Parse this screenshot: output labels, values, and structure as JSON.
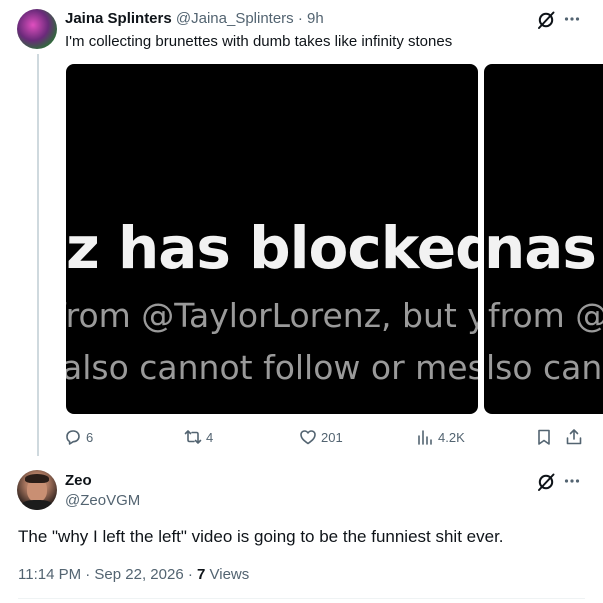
{
  "tweet1": {
    "author_name": "Jaina Splinters",
    "author_handle": "@Jaina_Splinters",
    "separator": " · ",
    "time": "9h",
    "text": "I'm collecting brunettes with dumb takes like infinity stones",
    "media": [
      {
        "line1": "z has blocked",
        "line2": "from @TaylorLorenz, but y",
        "line3": "also cannot follow or mess"
      },
      {
        "line1": "nas b",
        "line2": "from @",
        "line3": "lso can"
      }
    ],
    "actions": {
      "replies": "6",
      "reposts": "4",
      "likes": "201",
      "views": "4.2K"
    }
  },
  "tweet2": {
    "author_name": "Zeo",
    "author_handle": "@ZeoVGM",
    "text": "The \"why I left the left\" video is going to be the funniest shit ever.",
    "timestamp": "11:14 PM · Sep 22, 2026 · ",
    "views_count": "7",
    "views_label": " Views"
  },
  "icons": {
    "grok": "grok-icon",
    "more": "more-icon",
    "reply": "reply-icon",
    "repost": "repost-icon",
    "like": "heart-icon",
    "views": "views-icon",
    "bookmark": "bookmark-icon",
    "share": "share-icon"
  },
  "colors": {
    "text_primary": "#0f1419",
    "text_secondary": "#536471",
    "thread_line": "#cfd9de"
  }
}
